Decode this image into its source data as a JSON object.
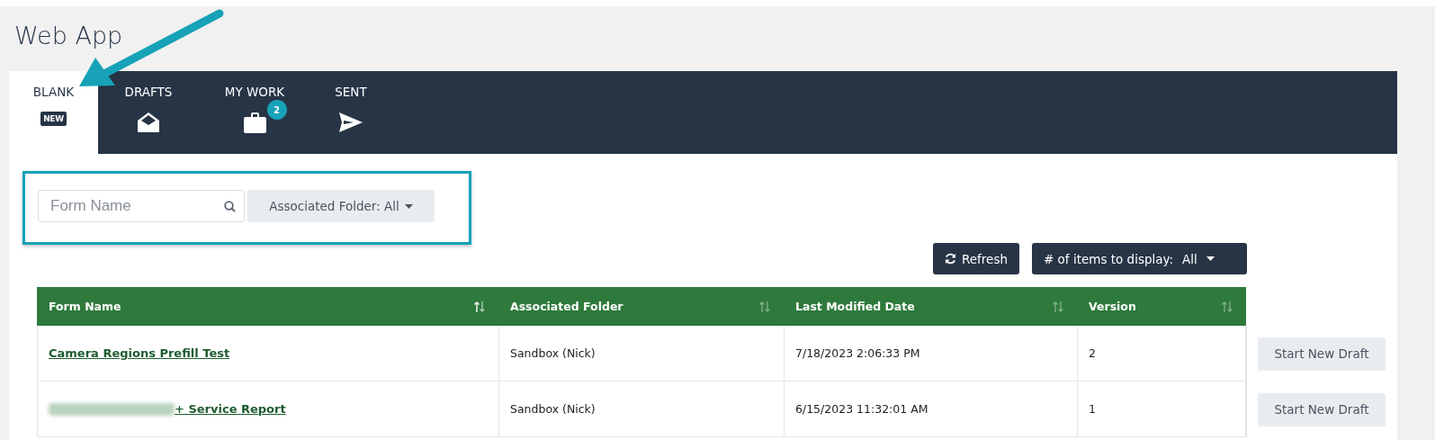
{
  "title": "Web App",
  "tabs": [
    {
      "label": "BLANK",
      "selected": true,
      "icon_text": "NEW"
    },
    {
      "label": "DRAFTS",
      "selected": false
    },
    {
      "label": "MY WORK",
      "selected": false,
      "badge": "2"
    },
    {
      "label": "SENT",
      "selected": false
    }
  ],
  "filters": {
    "highlighted": true,
    "search": {
      "placeholder": "Form Name"
    },
    "folder_dropdown": "Associated Folder: All"
  },
  "toolbar": {
    "refresh": "Refresh",
    "items_label": "# of items to display:",
    "items_value": "All"
  },
  "table": {
    "columns": [
      {
        "label": "Form Name",
        "sorted": true
      },
      {
        "label": "Associated Folder",
        "sorted": false
      },
      {
        "label": "Last Modified Date",
        "sorted": false
      },
      {
        "label": "Version",
        "sorted": false
      }
    ],
    "rows": [
      {
        "form_name": "Camera Regions Prefill Test",
        "redacted_prefix": false,
        "folder": "Sandbox (Nick)",
        "modified": "7/18/2023 2:06:33 PM",
        "version": "2",
        "action": "Start New Draft"
      },
      {
        "form_name": "+ Service Report",
        "redacted_prefix": true,
        "folder": "Sandbox (Nick)",
        "modified": "6/15/2023 11:32:01 AM",
        "version": "1",
        "action": "Start New Draft"
      }
    ]
  },
  "annotations": {
    "arrow": true
  }
}
